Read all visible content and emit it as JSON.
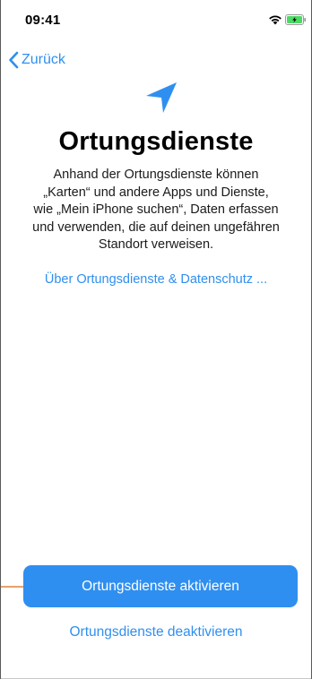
{
  "status_bar": {
    "time": "09:41",
    "wifi_icon": "wifi-icon",
    "battery_icon": "battery-charging-icon",
    "battery_color": "#4cd964"
  },
  "nav": {
    "back_label": "Zurück",
    "back_icon": "chevron-left-icon"
  },
  "hero": {
    "icon": "location-arrow-icon"
  },
  "content": {
    "title": "Ortungsdienste",
    "description_lines": [
      "Anhand der Ortungsdienste können",
      "„Karten“ und andere Apps und Dienste,",
      "wie „Mein iPhone suchen“, Daten erfassen",
      "und verwenden, die auf deinen ungefähren",
      "Standort verweisen."
    ],
    "privacy_link": "Über Ortungsdienste & Datenschutz ..."
  },
  "actions": {
    "enable_label": "Ortungsdienste aktivieren",
    "disable_label": "Ortungsdienste deaktivieren"
  },
  "colors": {
    "accent": "#2f8ff0",
    "annotation": "#e9a06a"
  }
}
